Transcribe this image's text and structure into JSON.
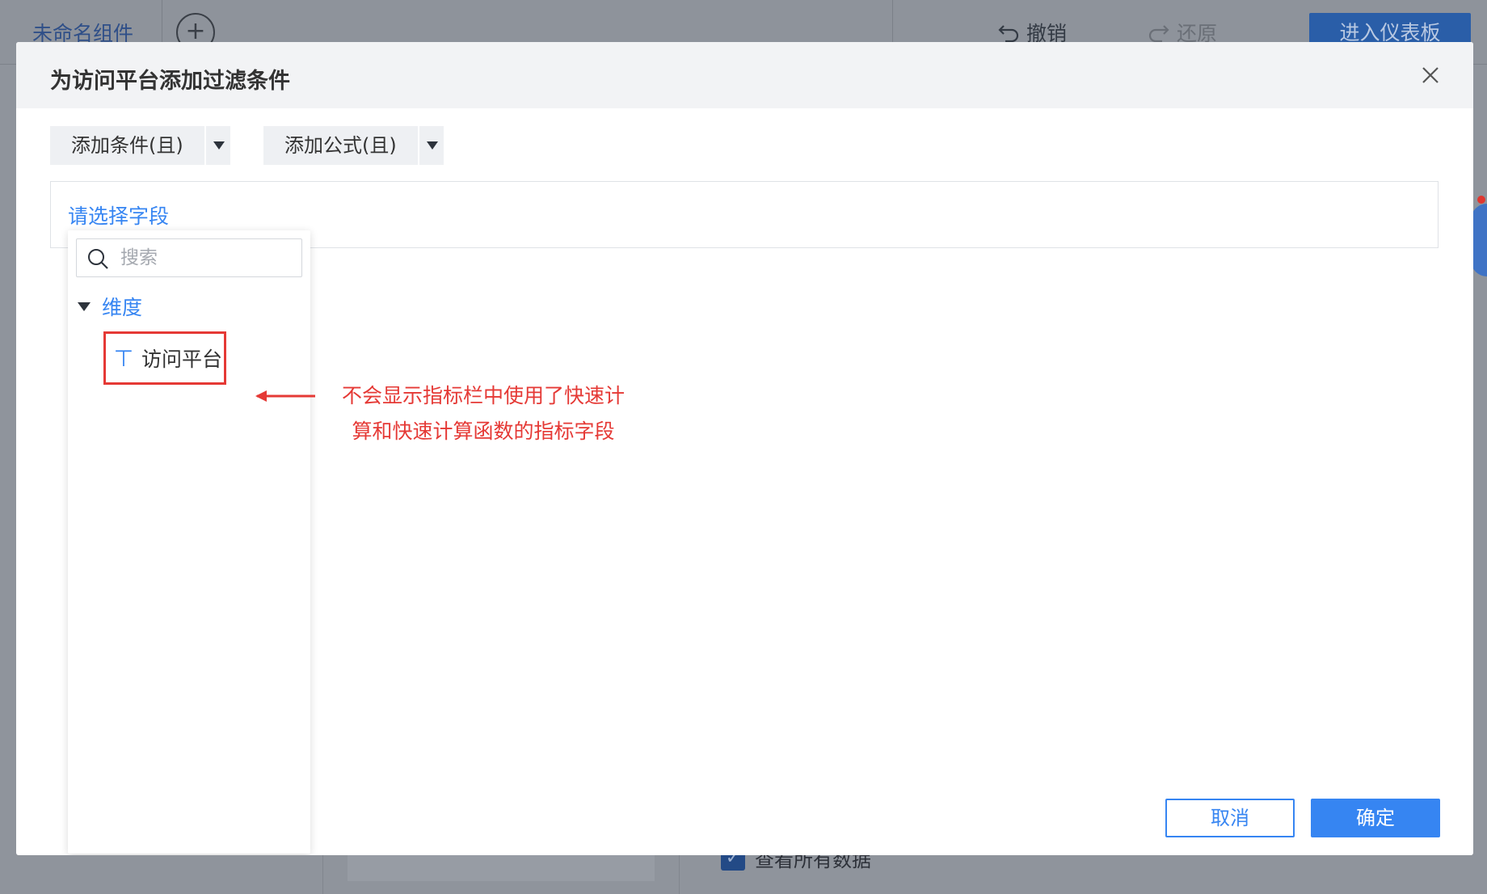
{
  "background": {
    "tab_label": "未命名组件",
    "undo_label": "撤销",
    "redo_label": "还原",
    "enter_dashboard_label": "进入仪表板",
    "check_all_label": "查看所有数据"
  },
  "modal": {
    "title": "为访问平台添加过滤条件",
    "add_condition_label": "添加条件(且)",
    "add_formula_label": "添加公式(且)",
    "field_select_placeholder": "请选择字段",
    "cancel_label": "取消",
    "confirm_label": "确定"
  },
  "dropdown": {
    "search_placeholder": "搜索",
    "group_label": "维度",
    "items": [
      {
        "label": "访问平台",
        "type_icon": "text-type-icon"
      }
    ]
  },
  "annotation": {
    "line1": "不会显示指标栏中使用了快速计",
    "line2": "算和快速计算函数的指标字段",
    "color": "#e53935"
  },
  "colors": {
    "accent": "#3685f2",
    "highlight": "#e53935"
  }
}
